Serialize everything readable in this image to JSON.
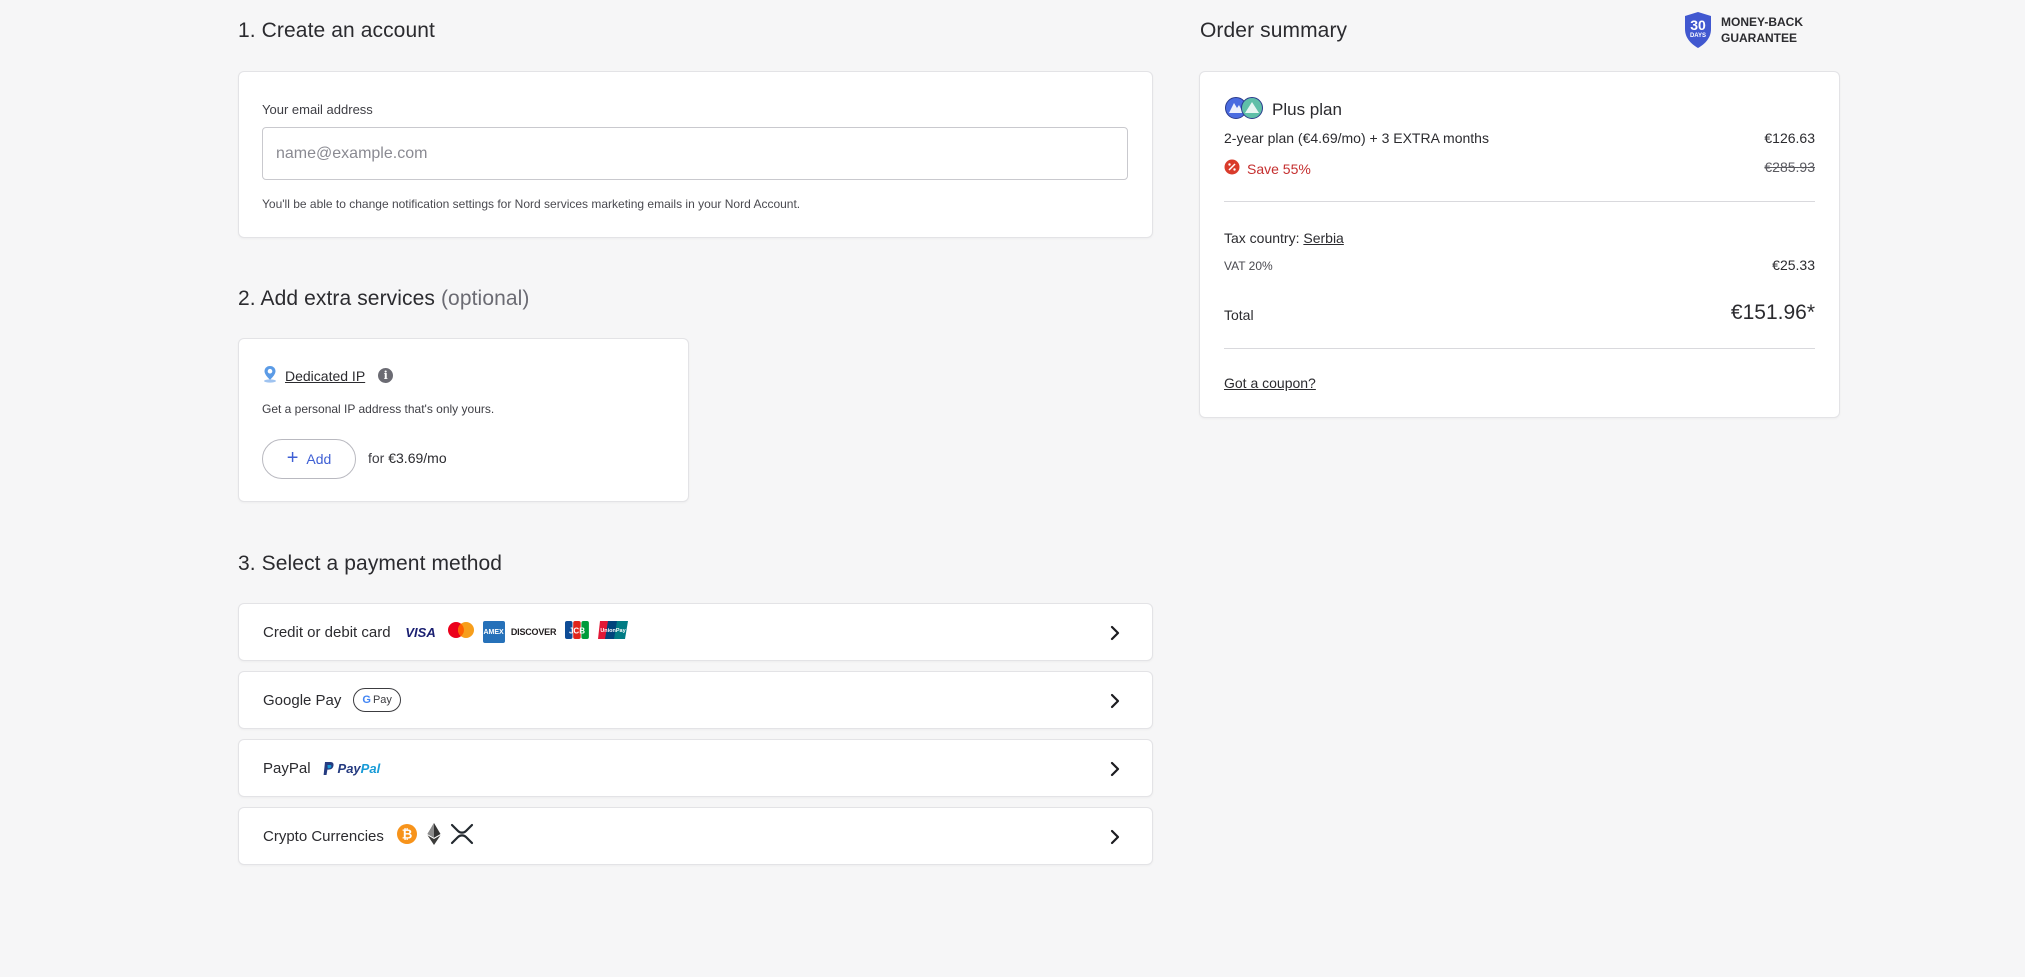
{
  "colors": {
    "background": "#f6f6f7",
    "accent": "#3e5fd4",
    "save_red": "#c52f2f",
    "badge_blue": "#4158d0"
  },
  "step1": {
    "heading": "1. Create an account",
    "email_label": "Your email address",
    "email_placeholder": "name@example.com",
    "email_value": "",
    "hint": "You'll be able to change notification settings for Nord services marketing emails in your Nord Account."
  },
  "step2": {
    "heading": "2. Add extra services",
    "heading_optional": "(optional)",
    "service": {
      "icon": "location-pin-icon",
      "name": "Dedicated IP",
      "description": "Get a personal IP address that's only yours.",
      "add_label": "Add",
      "price_prefix": "for",
      "price": "€3.69/mo"
    }
  },
  "step3": {
    "heading": "3. Select a payment method",
    "methods": [
      {
        "label": "Credit or debit card",
        "logos": [
          "VISA",
          "mastercard",
          "AMEX",
          "DISCOVER",
          "JCB",
          "UnionPay"
        ]
      },
      {
        "label": "Google Pay",
        "logos": [
          "G Pay"
        ]
      },
      {
        "label": "PayPal",
        "logos": [
          "PayPal"
        ]
      },
      {
        "label": "Crypto Currencies",
        "logos": [
          "bitcoin-icon",
          "ethereum-icon",
          "ripple-icon"
        ]
      }
    ]
  },
  "summary": {
    "heading": "Order summary",
    "guarantee_badge_number": "30",
    "guarantee_badge_unit": "DAYS",
    "guarantee_line1": "MONEY-BACK",
    "guarantee_line2": "GUARANTEE",
    "plan_name": "Plus plan",
    "plan_desc": "2-year plan (€4.69/mo) + 3 EXTRA months",
    "plan_price": "€126.63",
    "save_label": "Save 55%",
    "old_price": "€285.93",
    "tax_label": "Tax country:",
    "tax_country": "Serbia",
    "vat_label": "VAT 20%",
    "vat_value": "€25.33",
    "total_label": "Total",
    "total_value": "€151.96*",
    "coupon_label": "Got a coupon?"
  }
}
